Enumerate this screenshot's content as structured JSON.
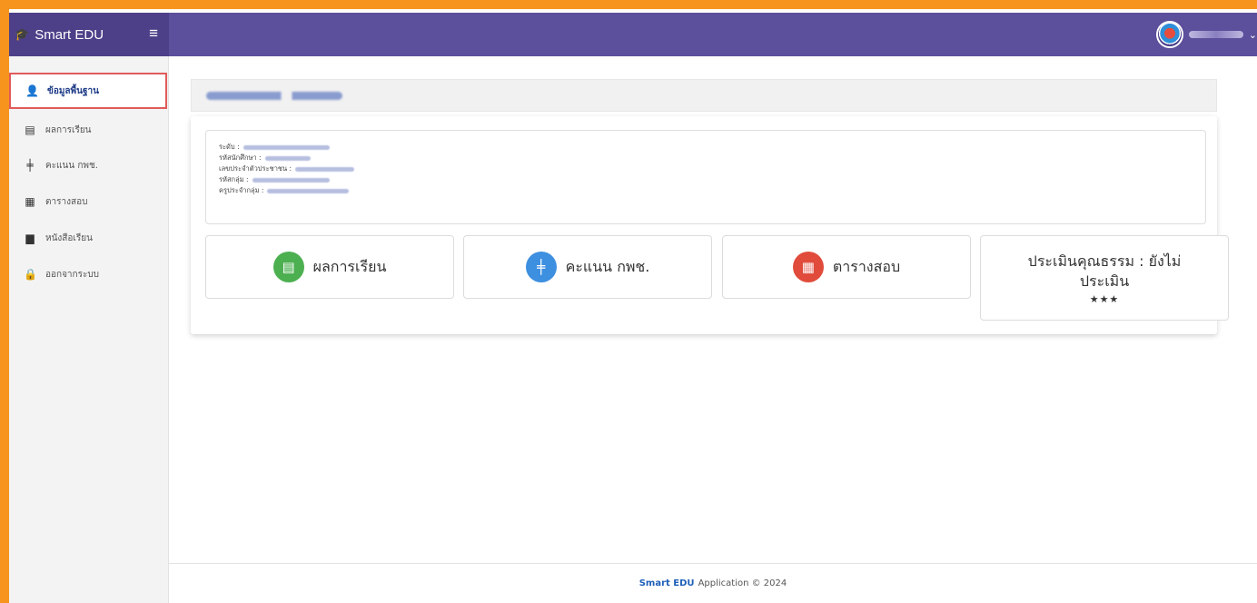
{
  "app": {
    "brand": "Smart EDU"
  },
  "sidebar": {
    "items": [
      {
        "label": "ข้อมูลพื้นฐาน",
        "icon": "user-icon"
      },
      {
        "label": "ผลการเรียน",
        "icon": "id-card-icon"
      },
      {
        "label": "คะแนน กพช.",
        "icon": "signpost-icon"
      },
      {
        "label": "ตารางสอบ",
        "icon": "calendar-check-icon"
      },
      {
        "label": "หนังสือเรียน",
        "icon": "book-icon"
      },
      {
        "label": "ออกจากระบบ",
        "icon": "lock-icon"
      }
    ]
  },
  "info": {
    "level_label": "ระดับ :",
    "student_id_label": "รหัสนักศึกษา :",
    "citizen_id_label": "เลขประจำตัวประชาชน :",
    "group_id_label": "รหัสกลุ่ม :",
    "group_teacher_label": "ครูประจำกลุ่ม :"
  },
  "tiles": {
    "grades": "ผลการเรียน",
    "score": "คะแนน กพช.",
    "exam": "ตารางสอบ",
    "moral": "ประเมินคุณธรรม : ยังไม่ประเมิน",
    "moral_stars": "★★★"
  },
  "footer": {
    "brand": "Smart EDU",
    "text": "Application © 2024"
  },
  "colors": {
    "topbar": "#5c4f9c",
    "brand_bg": "#4d4088",
    "frame": "#f7941d",
    "grades_icon": "#4caf50",
    "score_icon": "#3d8fe0",
    "exam_icon": "#e14b3b"
  }
}
